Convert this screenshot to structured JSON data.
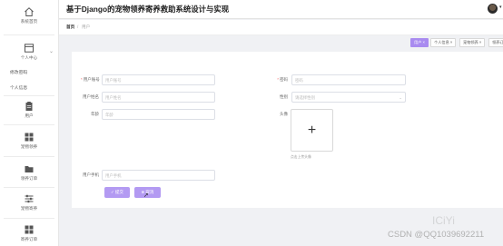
{
  "app": {
    "title": "基于Django的宠物领养寄养救助系统设计与实现"
  },
  "sidebar": {
    "items": [
      {
        "label": "系统首页",
        "icon": "home-icon"
      },
      {
        "label": "个人中心",
        "icon": "profile-card-icon"
      },
      {
        "label": "用户",
        "icon": "clipboard-icon"
      },
      {
        "label": "宠物领养",
        "icon": "grid-icon"
      },
      {
        "label": "领养订单",
        "icon": "folder-icon"
      },
      {
        "label": "宠物寄养",
        "icon": "sliders-icon"
      },
      {
        "label": "寄养订单",
        "icon": "grid-icon"
      }
    ],
    "subitems": [
      {
        "label": "修改密码"
      },
      {
        "label": "个人信息"
      }
    ]
  },
  "breadcrumb": {
    "home": "首页",
    "separator": "/",
    "current": "用户"
  },
  "tabs": [
    {
      "label": "用户 ×",
      "active": true
    },
    {
      "label": "个人信息 ×",
      "active": false
    },
    {
      "label": "宠物领养 ×",
      "active": false
    },
    {
      "label": "领养订单 ×",
      "active": false
    }
  ],
  "form": {
    "account": {
      "label": "用户账号",
      "placeholder": "用户账号",
      "required": true
    },
    "password": {
      "label": "密码",
      "placeholder": "密码",
      "required": true
    },
    "name": {
      "label": "用户姓名",
      "placeholder": "用户姓名"
    },
    "gender": {
      "label": "性别",
      "placeholder": "请选择性别"
    },
    "age": {
      "label": "年龄",
      "placeholder": "年龄"
    },
    "avatar": {
      "label": "头像",
      "tip": "点击上传头像"
    },
    "phone": {
      "label": "用户手机",
      "placeholder": "用户手机"
    },
    "required_mark": "*"
  },
  "buttons": {
    "submit": "提交",
    "cancel": "取消"
  },
  "watermark": {
    "faint": "ICiYi",
    "text": "CSDN @QQ1039692211"
  },
  "colors": {
    "accent": "#a98bf0",
    "button": "#b39af2",
    "required": "#f56c6c"
  }
}
